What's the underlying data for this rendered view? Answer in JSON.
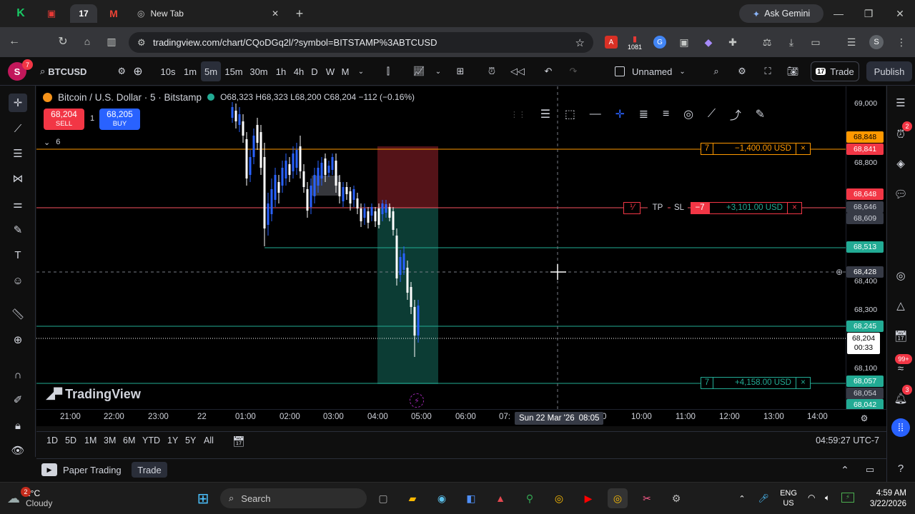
{
  "browser": {
    "tabs": [
      {
        "label": "",
        "icon": "kite-icon"
      },
      {
        "label": "",
        "icon": "youtube-studio-icon"
      },
      {
        "label": "",
        "icon": "tradingview-icon"
      },
      {
        "label": "",
        "icon": "gmail-icon"
      },
      {
        "label": "New Tab",
        "icon": "chrome-icon"
      }
    ],
    "ask_gemini": "Ask Gemini",
    "url": "tradingview.com/chart/CQoDGq2l/?symbol=BITSTAMP%3ABTCUSD",
    "ext_badge": "1081",
    "avatar": "S"
  },
  "toolbar": {
    "avatar_letter": "S",
    "notif_count": "7",
    "symbol": "BTCUSD",
    "intervals": [
      "10s",
      "1m",
      "5m",
      "15m",
      "30m",
      "1h",
      "4h",
      "D",
      "W",
      "M"
    ],
    "active_interval": "5m",
    "layout_name": "Unnamed",
    "trade_label": "Trade",
    "publish_label": "Publish"
  },
  "legend": {
    "title": "Bitcoin / U.S. Dollar · 5 · Bitstamp",
    "ohlc": "O68,323 H68,323 L68,200 C68,204 −112 (−0.16%)",
    "sell_price": "68,204",
    "sell_label": "SELL",
    "qty": "1",
    "buy_price": "68,205",
    "buy_label": "BUY",
    "indicators_count": "6"
  },
  "orders": {
    "top": {
      "qty": "7",
      "pnl": "−1,400.00 USD",
      "close": "×"
    },
    "position": {
      "bracket": "⅟",
      "tp": "TP",
      "sl": "SL",
      "qty": "−7",
      "pnl": "+3,101.00 USD",
      "close": "×"
    },
    "bottom": {
      "qty": "7",
      "pnl": "+4,158.00 USD",
      "close": "×"
    }
  },
  "price_axis": {
    "ticks": [
      "69,000",
      "68,800",
      "68,400",
      "68,300",
      "68,100"
    ],
    "labels": [
      {
        "text": "68,848",
        "kind": "orange"
      },
      {
        "text": "68,841",
        "kind": "red"
      },
      {
        "text": "68,648",
        "kind": "red"
      },
      {
        "text": "68,646",
        "kind": "grey"
      },
      {
        "text": "68,609",
        "kind": "grey"
      },
      {
        "text": "68,513",
        "kind": "green"
      },
      {
        "text": "68,428",
        "kind": "dark"
      },
      {
        "text": "68,245",
        "kind": "green"
      },
      {
        "text": "68,204",
        "kind": "white"
      },
      {
        "text": "00:33",
        "kind": "white"
      },
      {
        "text": "68,057",
        "kind": "green"
      },
      {
        "text": "68,054",
        "kind": "grey"
      },
      {
        "text": "68,042",
        "kind": "green"
      }
    ]
  },
  "time_axis": {
    "ticks": [
      "21:00",
      "22:00",
      "23:00",
      "22",
      "01:00",
      "02:00",
      "03:00",
      "04:00",
      "05:00",
      "06:00",
      "07:",
      "0",
      "10:00",
      "11:00",
      "12:00",
      "13:00",
      "14:00"
    ],
    "cursor_label": "Sun 22 Mar '26",
    "cursor_time": "08:05"
  },
  "watermark": "TradingView",
  "ranges": [
    "1D",
    "5D",
    "1M",
    "3M",
    "6M",
    "YTD",
    "1Y",
    "5Y",
    "All"
  ],
  "clock": "04:59:27 UTC-7",
  "bottom_panel": {
    "paper_trading": "Paper Trading",
    "trade": "Trade"
  },
  "right_badges": {
    "alerts": "2",
    "notifications": "99+",
    "calendar": "3"
  },
  "taskbar": {
    "weather_badge": "2",
    "temp": "1°C",
    "weather": "Cloudy",
    "search": "Search",
    "lang1": "ENG",
    "lang2": "US",
    "time": "4:59 AM",
    "date": "3/22/2026"
  },
  "colors": {
    "up": "#2962ff",
    "down": "#ffffff",
    "sl_line": "#f7525f",
    "tp_line": "#22ab94",
    "orange": "#ff9800",
    "green_label": "#22ab94",
    "red_label": "#f23645"
  }
}
